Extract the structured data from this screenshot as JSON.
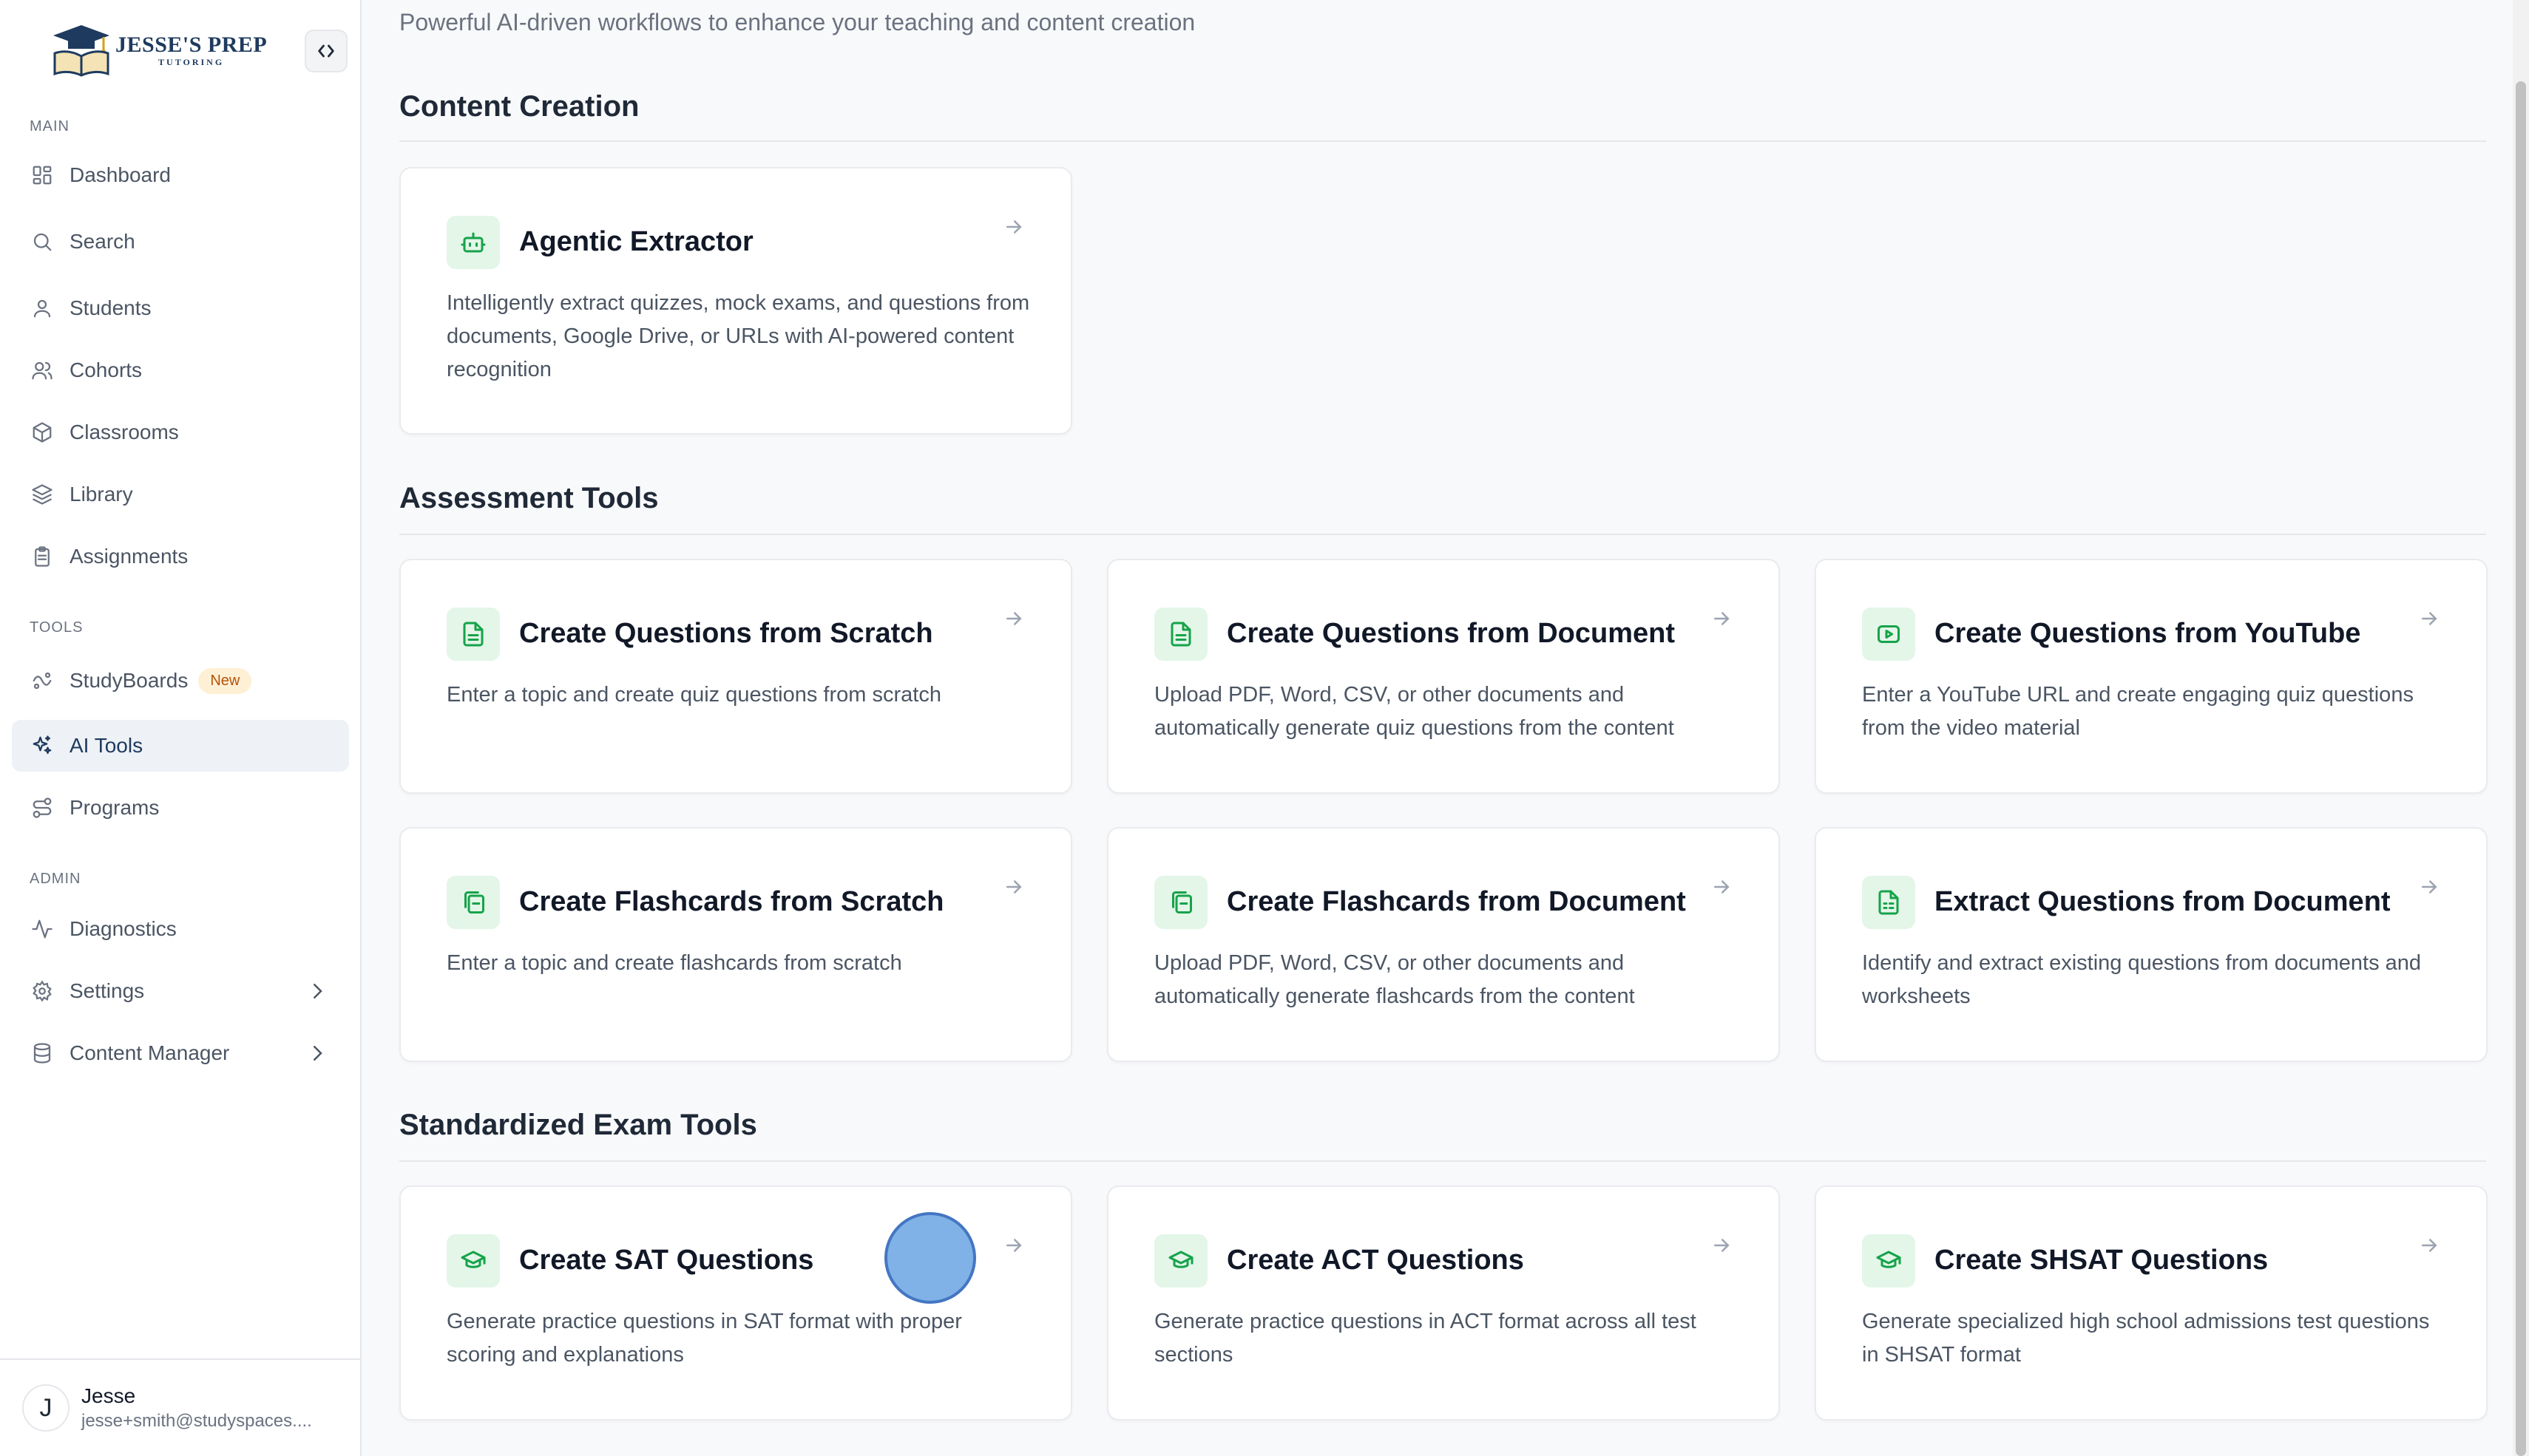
{
  "brand": {
    "title": "JESSE'S PREP",
    "subtitle": "TUTORING"
  },
  "sidebar": {
    "sections": {
      "main": "MAIN",
      "tools": "TOOLS",
      "admin": "ADMIN"
    },
    "items": [
      {
        "label": "Dashboard",
        "icon": "dashboard-icon"
      },
      {
        "label": "Search",
        "icon": "search-icon"
      },
      {
        "label": "Students",
        "icon": "user-icon"
      },
      {
        "label": "Cohorts",
        "icon": "users-icon"
      },
      {
        "label": "Classrooms",
        "icon": "box-icon"
      },
      {
        "label": "Library",
        "icon": "layers-icon"
      },
      {
        "label": "Assignments",
        "icon": "clipboard-icon"
      },
      {
        "label": "StudyBoards",
        "icon": "studyboards-icon",
        "badge": "New"
      },
      {
        "label": "AI Tools",
        "icon": "sparkles-icon",
        "active": true
      },
      {
        "label": "Programs",
        "icon": "route-icon"
      },
      {
        "label": "Diagnostics",
        "icon": "activity-icon"
      },
      {
        "label": "Settings",
        "icon": "gear-icon"
      },
      {
        "label": "Content Manager",
        "icon": "database-icon"
      }
    ]
  },
  "user": {
    "initial": "J",
    "name": "Jesse",
    "email": "jesse+smith@studyspaces...."
  },
  "main": {
    "subtitle": "Powerful AI-driven workflows to enhance your teaching and content creation",
    "sections": [
      {
        "title": "Content Creation",
        "cards": [
          {
            "title": "Agentic Extractor",
            "icon": "robot-icon",
            "description": "Intelligently extract quizzes, mock exams, and questions from documents, Google Drive, or URLs with AI-powered content recognition"
          }
        ]
      },
      {
        "title": "Assessment Tools",
        "cards": [
          {
            "title": "Create Questions from Scratch",
            "icon": "file-text-icon",
            "description": "Enter a topic and create quiz questions from scratch"
          },
          {
            "title": "Create Questions from Document",
            "icon": "file-text-icon",
            "description": "Upload PDF, Word, CSV, or other documents and automatically generate quiz questions from the content"
          },
          {
            "title": "Create Questions from YouTube",
            "icon": "youtube-icon",
            "description": "Enter a YouTube URL and create engaging quiz questions from the video material"
          },
          {
            "title": "Create Flashcards from Scratch",
            "icon": "flashcards-icon",
            "description": "Enter a topic and create flashcards from scratch"
          },
          {
            "title": "Create Flashcards from Document",
            "icon": "flashcards-icon",
            "description": "Upload PDF, Word, CSV, or other documents and automatically generate flashcards from the content"
          },
          {
            "title": "Extract Questions from Document",
            "icon": "file-spreadsheet-icon",
            "description": "Identify and extract existing questions from documents and worksheets"
          }
        ]
      },
      {
        "title": "Standardized Exam Tools",
        "cards": [
          {
            "title": "Create SAT Questions",
            "icon": "graduation-cap-icon",
            "description": "Generate practice questions in SAT format with proper scoring and explanations"
          },
          {
            "title": "Create ACT Questions",
            "icon": "graduation-cap-icon",
            "description": "Generate practice questions in ACT format across all test sections"
          },
          {
            "title": "Create SHSAT Questions",
            "icon": "graduation-cap-icon",
            "description": "Generate specialized high school admissions test questions in SHSAT format"
          }
        ]
      }
    ]
  },
  "colors": {
    "accent": "#16a34a",
    "accent_bg": "#e3f6e8",
    "brand": "#1e3a5f",
    "badge_bg": "#fdf0d5",
    "badge_fg": "#b45309"
  }
}
